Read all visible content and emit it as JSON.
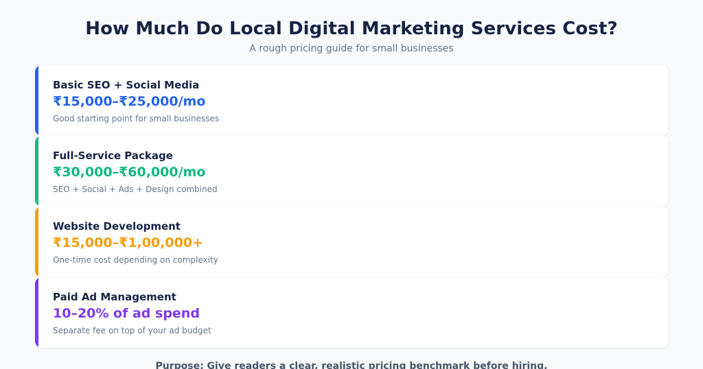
{
  "header": {
    "title": "How Much Do Local Digital Marketing Services Cost?",
    "subtitle": "A rough pricing guide for small businesses"
  },
  "cards": [
    {
      "name": "Basic SEO + Social Media",
      "price": "₹15,000–₹25,000/mo",
      "description": "Good starting point for small businesses",
      "color": "#2563eb"
    },
    {
      "name": "Full-Service Package",
      "price": "₹30,000–₹60,000/mo",
      "description": "SEO + Social + Ads + Design combined",
      "color": "#10b981"
    },
    {
      "name": "Website Development",
      "price": "₹15,000–₹1,00,000+",
      "description": "One-time cost depending on complexity",
      "color": "#f59e0b"
    },
    {
      "name": "Paid Ad Management",
      "price": "10–20% of ad spend",
      "description": "Separate fee on top of your ad budget",
      "color": "#7c3aed"
    }
  ],
  "footer": {
    "text": "Purpose: Give readers a clear, realistic pricing benchmark before hiring."
  }
}
